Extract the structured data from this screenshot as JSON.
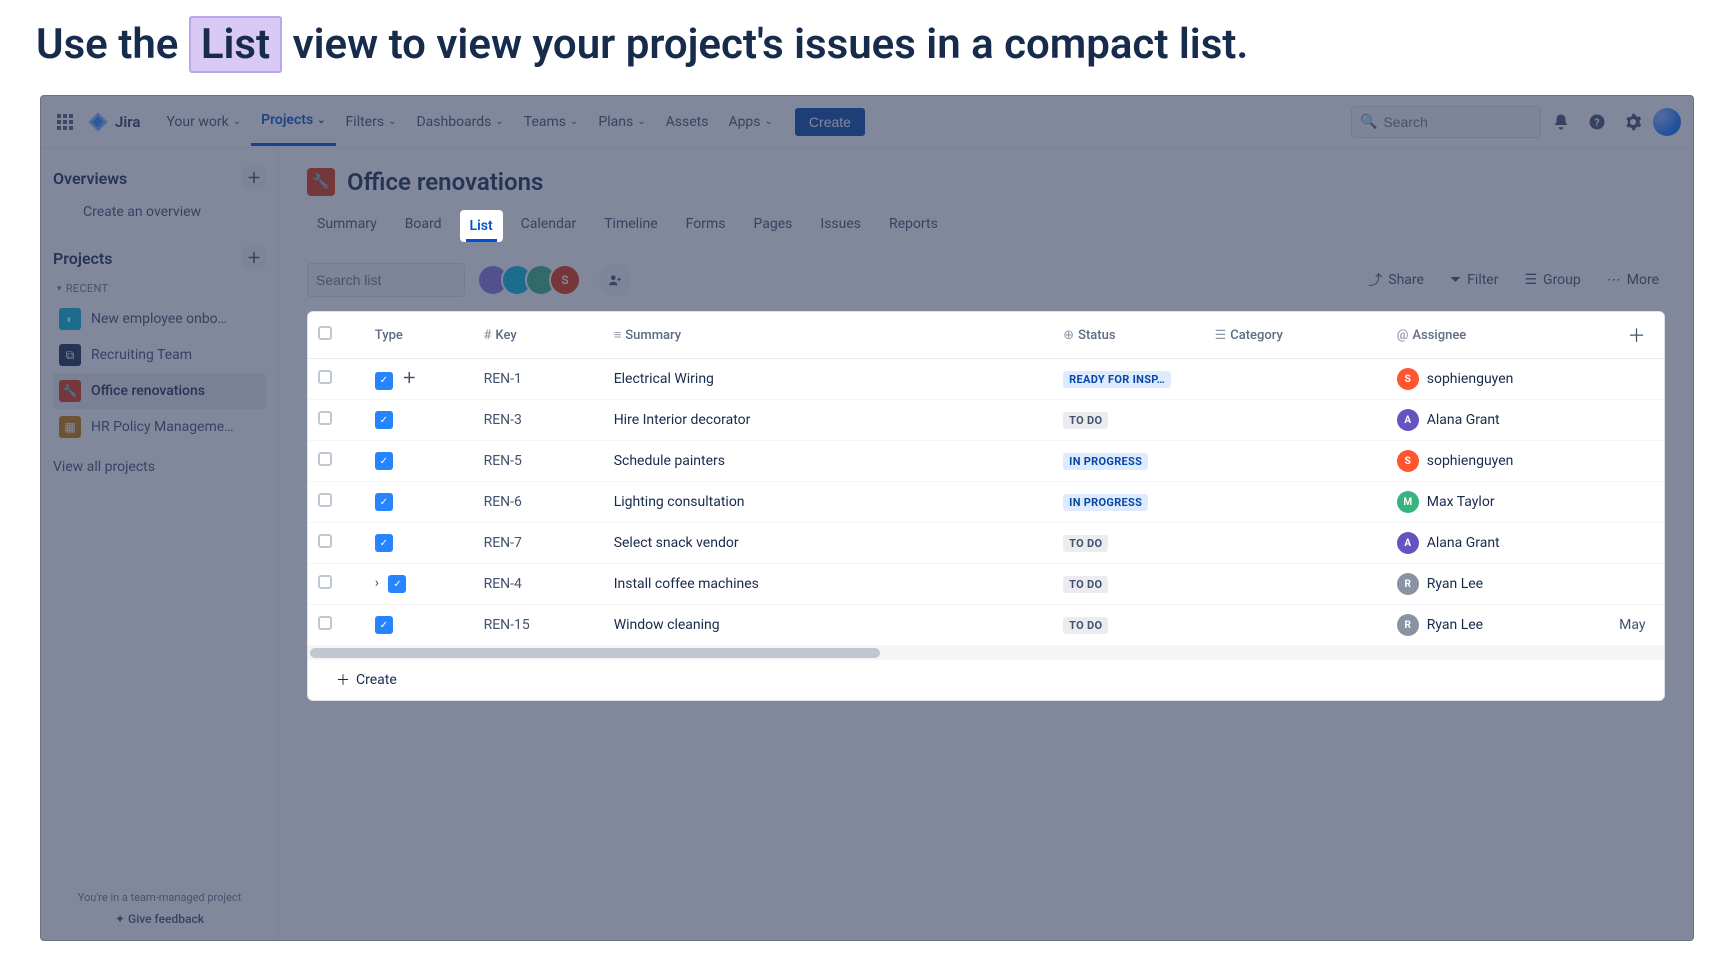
{
  "instruction": {
    "prefix": "Use the ",
    "highlight": "List",
    "suffix": " view to view your project's issues in a compact list."
  },
  "topnav": {
    "brand": "Jira",
    "items": [
      "Your work",
      "Projects",
      "Filters",
      "Dashboards",
      "Teams",
      "Plans",
      "Assets",
      "Apps"
    ],
    "active_index": 1,
    "create_label": "Create",
    "search_placeholder": "Search"
  },
  "sidebar": {
    "overviews_label": "Overviews",
    "create_overview_label": "Create an overview",
    "projects_label": "Projects",
    "recent_label": "RECENT",
    "view_all_label": "View all projects",
    "projects": [
      {
        "name": "New employee onbo…",
        "color": "#00B8D9",
        "initial": "◐"
      },
      {
        "name": "Recruiting Team",
        "color": "#172B4D",
        "initial": "⧉"
      },
      {
        "name": "Office renovations",
        "color": "#DE350B",
        "initial": "🔧",
        "selected": true
      },
      {
        "name": "HR Policy Manageme…",
        "color": "#C77B00",
        "initial": "▦"
      }
    ],
    "footer_note": "You're in a team-managed project",
    "feedback_label": "Give feedback"
  },
  "project": {
    "name": "Office renovations",
    "tabs": [
      "Summary",
      "Board",
      "List",
      "Calendar",
      "Timeline",
      "Forms",
      "Pages",
      "Issues",
      "Reports"
    ],
    "active_tab": "List"
  },
  "toolbar": {
    "search_placeholder": "Search list",
    "share_label": "Share",
    "filter_label": "Filter",
    "group_label": "Group",
    "more_label": "More"
  },
  "columns": {
    "type": "Type",
    "key": "Key",
    "summary": "Summary",
    "status": "Status",
    "category": "Category",
    "assignee": "Assignee"
  },
  "rows": [
    {
      "key": "REN-1",
      "summary": "Electrical Wiring",
      "status": "READY FOR INSP…",
      "status_cls": "status-ready",
      "assignee": "sophienguyen",
      "av_bg": "#FF5630",
      "av_txt": "S",
      "has_plus": true
    },
    {
      "key": "REN-3",
      "summary": "Hire Interior decorator",
      "status": "TO DO",
      "status_cls": "status-todo",
      "assignee": "Alana Grant",
      "av_bg": "#6554C0",
      "av_txt": "A"
    },
    {
      "key": "REN-5",
      "summary": "Schedule painters",
      "status": "IN PROGRESS",
      "status_cls": "status-prog",
      "assignee": "sophienguyen",
      "av_bg": "#FF5630",
      "av_txt": "S"
    },
    {
      "key": "REN-6",
      "summary": "Lighting consultation",
      "status": "IN PROGRESS",
      "status_cls": "status-prog",
      "assignee": "Max Taylor",
      "av_bg": "#36B37E",
      "av_txt": "M"
    },
    {
      "key": "REN-7",
      "summary": "Select snack vendor",
      "status": "TO DO",
      "status_cls": "status-todo",
      "assignee": "Alana Grant",
      "av_bg": "#6554C0",
      "av_txt": "A"
    },
    {
      "key": "REN-4",
      "summary": "Install coffee machines",
      "status": "TO DO",
      "status_cls": "status-todo",
      "assignee": "Ryan Lee",
      "av_bg": "#8993A4",
      "av_txt": "R",
      "has_expand": true
    },
    {
      "key": "REN-15",
      "summary": "Window cleaning",
      "status": "TO DO",
      "status_cls": "status-todo",
      "assignee": "Ryan Lee",
      "av_bg": "#8993A4",
      "av_txt": "R",
      "extra": "May"
    }
  ],
  "create_row_label": "Create"
}
